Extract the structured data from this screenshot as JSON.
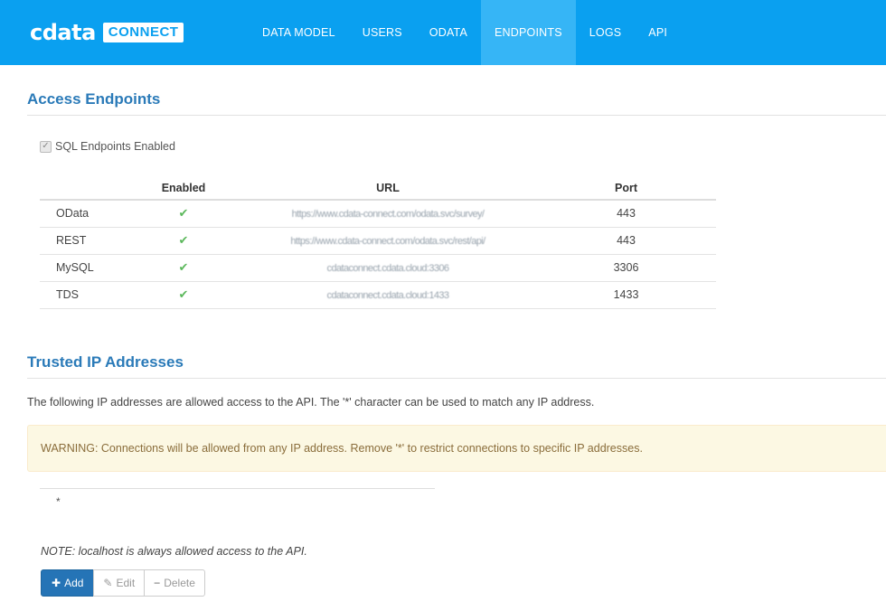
{
  "header": {
    "logo_main": "cdata",
    "logo_badge": "CONNECT",
    "nav": [
      {
        "label": "DATA MODEL"
      },
      {
        "label": "USERS"
      },
      {
        "label": "ODATA"
      },
      {
        "label": "ENDPOINTS",
        "active": true
      },
      {
        "label": "LOGS"
      },
      {
        "label": "API"
      }
    ]
  },
  "access": {
    "title": "Access Endpoints",
    "sql_enabled_label": "SQL Endpoints Enabled",
    "columns": {
      "enabled": "Enabled",
      "url": "URL",
      "port": "Port"
    },
    "rows": [
      {
        "name": "OData",
        "url": "https://www.cdata-connect.com/odata.svc/survey/",
        "port": "443"
      },
      {
        "name": "REST",
        "url": "https://www.cdata-connect.com/odata.svc/rest/api/",
        "port": "443"
      },
      {
        "name": "MySQL",
        "url": "cdataconnect.cdata.cloud:3306",
        "port": "3306"
      },
      {
        "name": "TDS",
        "url": "cdataconnect.cdata.cloud:1433",
        "port": "1433"
      }
    ]
  },
  "trusted": {
    "title": "Trusted IP Addresses",
    "description": "The following IP addresses are allowed access to the API. The '*' character can be used to match any IP address.",
    "warning": "WARNING: Connections will be allowed from any IP address. Remove '*' to restrict connections to specific IP addresses.",
    "ips": [
      "*"
    ],
    "note": "NOTE: localhost is always allowed access to the API.",
    "buttons": {
      "add": "Add",
      "edit": "Edit",
      "delete": "Delete"
    }
  },
  "colors": {
    "header_bg": "#0aa0f0",
    "active_tab_bg": "#36b5f6",
    "title": "#2a7ab8",
    "warning_bg": "#fcf8e3",
    "check": "#5cb85c",
    "primary_button": "#2574b6"
  }
}
